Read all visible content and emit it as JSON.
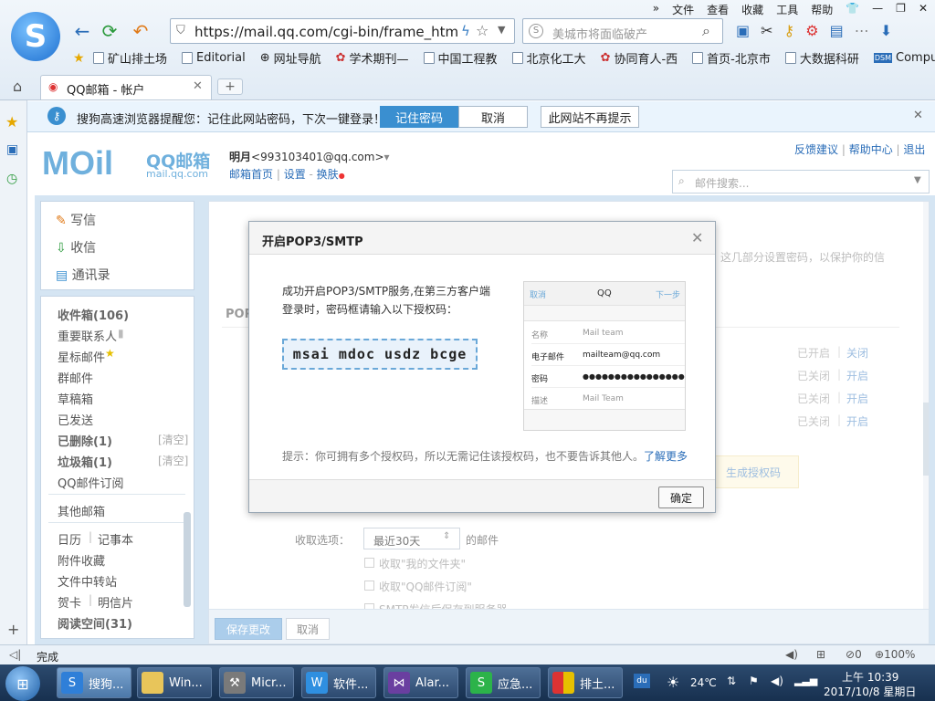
{
  "browser": {
    "menu": [
      "文件",
      "查看",
      "收藏",
      "工具",
      "帮助"
    ],
    "url": "https://mail.qq.com/cgi-bin/frame_html?si",
    "search_placeholder": "美城市将面临破产",
    "favorites": [
      "矿山排土场",
      "Editorial",
      "网址导航",
      "学术期刊—",
      "中国工程教",
      "北京化工大",
      "协同育人-西",
      "首页-北京市",
      "大数据科研",
      "Compute"
    ],
    "tab_title": "QQ邮箱 - 帐户",
    "tab_add": "+"
  },
  "notification": {
    "text": "搜狗高速浏览器提醒您：记住此网站密码，下次一键登录！",
    "btn_remember": "记住密码",
    "btn_cancel": "取消",
    "btn_never": "此网站不再提示"
  },
  "mail": {
    "logo_text": "MOil",
    "logo_cn": "QQ邮箱",
    "logo_domain": "mail.qq.com",
    "user_name": "明月",
    "user_email": "<993103401@qq.com>",
    "nav_home": "邮箱首页",
    "nav_settings": "设置",
    "nav_skin": "换肤",
    "top_links": [
      "反馈建议",
      "帮助中心",
      "退出"
    ],
    "search_placeholder": "邮件搜索...",
    "quick": [
      "写信",
      "收信",
      "通讯录"
    ],
    "folders": [
      {
        "label": "收件箱(106)",
        "bold": true
      },
      {
        "label": "重要联系人",
        "bold": false
      },
      {
        "label": "星标邮件",
        "bold": false
      },
      {
        "label": "群邮件",
        "bold": false
      },
      {
        "label": "草稿箱",
        "bold": false
      },
      {
        "label": "已发送",
        "bold": false
      },
      {
        "label": "已删除(1)",
        "bold": true
      },
      {
        "label": "垃圾箱(1)",
        "bold": true
      },
      {
        "label": "QQ邮件订阅",
        "bold": false
      }
    ],
    "clear_label": "[清空]",
    "other_mail": "其他邮箱",
    "tools": [
      "日历",
      "记事本",
      "附件收藏",
      "文件中转站",
      "贺卡",
      "明信片",
      "阅读空间(31)"
    ],
    "bg_text_right": "这几部分设置密码，以保护你的信",
    "bg_section": "POP",
    "toggle_rows": [
      {
        "state": "已开启",
        "action": "关闭"
      },
      {
        "state": "已关闭",
        "action": "开启"
      },
      {
        "state": "已关闭",
        "action": "开启"
      },
      {
        "state": "已关闭",
        "action": "开启"
      }
    ],
    "generate_btn": "生成授权码",
    "receive_label": "收取选项：",
    "receive_value": "最近30天",
    "receive_suffix": "的邮件",
    "check1": "收取\"我的文件夹\"",
    "check2": "收取\"QQ邮件订阅\"",
    "check3": "SMTP发信后保存到服务器",
    "save_btn": "保存更改",
    "cancel_btn": "取消"
  },
  "dialog": {
    "title": "开启POP3/SMTP",
    "line1": "成功开启POP3/SMTP服务,在第三方客户端",
    "line2": "登录时，密码框请输入以下授权码：",
    "code": "msai mdoc usdz bcge",
    "phone": {
      "cancel": "取消",
      "title": "QQ",
      "next": "下一步",
      "rows": [
        {
          "label": "名称",
          "value": "Mail team"
        },
        {
          "label": "电子邮件",
          "value": "mailteam@qq.com"
        },
        {
          "label": "密码",
          "value": "●●●●●●●●●●●●●●●●"
        },
        {
          "label": "描述",
          "value": "Mail Team"
        }
      ]
    },
    "hint": "提示：你可拥有多个授权码，所以无需记住该授权码，也不要告诉其他人。",
    "learn_more": "了解更多",
    "ok": "确定"
  },
  "status": {
    "text": "完成",
    "zoom": "100%",
    "count": "0",
    "count2": "0"
  },
  "taskbar": {
    "items": [
      "搜狗...",
      "Win...",
      "Micr...",
      "软件...",
      "Alar...",
      "应急...",
      "排土..."
    ],
    "temp": "24℃",
    "time": "上午 10:39",
    "date": "2017/10/8 星期日"
  },
  "colors": {
    "accent": "#3a8fd0",
    "link": "#2a6db8"
  }
}
